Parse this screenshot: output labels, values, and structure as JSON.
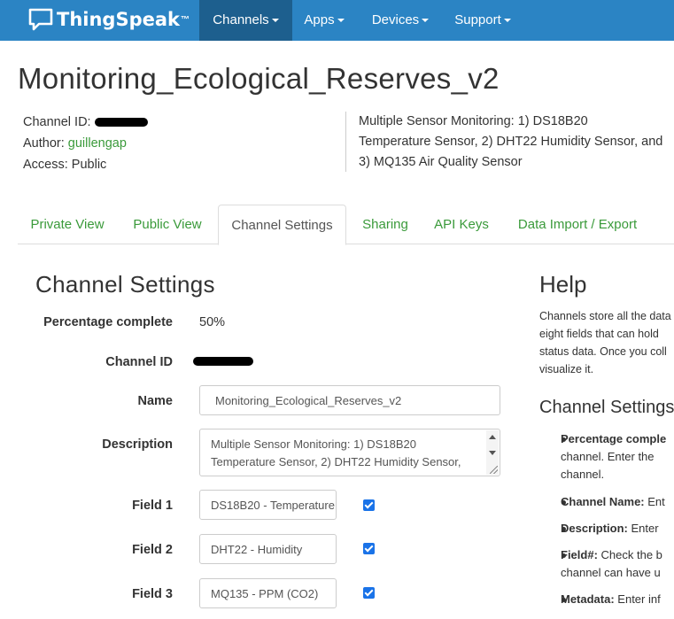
{
  "nav": {
    "brand": "ThingSpeak",
    "brand_tm": "™",
    "items": [
      {
        "label": "Channels"
      },
      {
        "label": "Apps"
      },
      {
        "label": "Devices"
      },
      {
        "label": "Support"
      }
    ]
  },
  "channel": {
    "title": "Monitoring_Ecological_Reserves_v2",
    "id_label": "Channel ID:",
    "author_label": "Author:",
    "author": "guillengap",
    "access_label": "Access:",
    "access": "Public",
    "description_lines": [
      "Multiple Sensor Monitoring: 1) DS18B20",
      "Temperature Sensor, 2) DHT22 Humidity Sensor, and",
      "3) MQ135 Air Quality Sensor"
    ]
  },
  "tabs": [
    {
      "label": "Private View"
    },
    {
      "label": "Public View"
    },
    {
      "label": "Channel Settings"
    },
    {
      "label": "Sharing"
    },
    {
      "label": "API Keys"
    },
    {
      "label": "Data Import / Export"
    }
  ],
  "settings": {
    "title": "Channel Settings",
    "percentage_label": "Percentage complete",
    "percentage_value": "50%",
    "channel_id_label": "Channel ID",
    "name_label": "Name",
    "name_value": "Monitoring_Ecological_Reserves_v2",
    "description_label": "Description",
    "description_lines": [
      "Multiple Sensor Monitoring: 1) DS18B20",
      "Temperature Sensor, 2) DHT22 Humidity Sensor,"
    ],
    "fields": [
      {
        "label": "Field 1",
        "value": "DS18B20 - Temperature",
        "checked": true
      },
      {
        "label": "Field 2",
        "value": "DHT22 - Humidity",
        "checked": true
      },
      {
        "label": "Field 3",
        "value": "MQ135 - PPM (CO2)",
        "checked": true
      }
    ]
  },
  "help": {
    "title": "Help",
    "text_lines": [
      "Channels store all the data",
      "eight fields that can hold",
      "status data. Once you coll",
      "visualize it."
    ],
    "subtitle": "Channel Settings",
    "items": [
      {
        "term": "Percentage comple",
        "lines": [
          "channel. Enter the",
          "channel."
        ]
      },
      {
        "term": "Channel Name:",
        "rest": " Ent"
      },
      {
        "term": "Description:",
        "rest": " Enter"
      },
      {
        "term": "Field#:",
        "rest": " Check the b",
        "lines": [
          "channel can have u"
        ]
      },
      {
        "term": "Metadata:",
        "rest": " Enter inf"
      }
    ]
  },
  "colors": {
    "navbar": "#2b84c4",
    "navbar_active": "#1d5f8e",
    "link_green": "#3a9a3a",
    "checkbox": "#1a73e8"
  }
}
